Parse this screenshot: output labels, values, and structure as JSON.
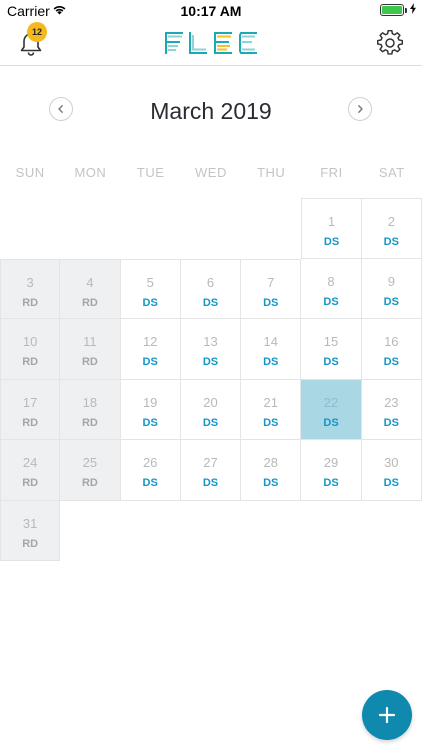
{
  "status_bar": {
    "carrier": "Carrier",
    "time": "10:17 AM"
  },
  "header": {
    "notification_count": "12",
    "logo_text": "FLEC"
  },
  "calendar": {
    "month_title": "March 2019",
    "weekdays": [
      "SUN",
      "MON",
      "TUE",
      "WED",
      "THU",
      "FRI",
      "SAT"
    ],
    "start_weekday_index": 5,
    "selected_day": "22",
    "days": [
      {
        "num": "1",
        "code": "DS"
      },
      {
        "num": "2",
        "code": "DS"
      },
      {
        "num": "3",
        "code": "RD"
      },
      {
        "num": "4",
        "code": "RD"
      },
      {
        "num": "5",
        "code": "DS"
      },
      {
        "num": "6",
        "code": "DS"
      },
      {
        "num": "7",
        "code": "DS"
      },
      {
        "num": "8",
        "code": "DS"
      },
      {
        "num": "9",
        "code": "DS"
      },
      {
        "num": "10",
        "code": "RD"
      },
      {
        "num": "11",
        "code": "RD"
      },
      {
        "num": "12",
        "code": "DS"
      },
      {
        "num": "13",
        "code": "DS"
      },
      {
        "num": "14",
        "code": "DS"
      },
      {
        "num": "15",
        "code": "DS"
      },
      {
        "num": "16",
        "code": "DS"
      },
      {
        "num": "17",
        "code": "RD"
      },
      {
        "num": "18",
        "code": "RD"
      },
      {
        "num": "19",
        "code": "DS"
      },
      {
        "num": "20",
        "code": "DS"
      },
      {
        "num": "21",
        "code": "DS"
      },
      {
        "num": "22",
        "code": "DS"
      },
      {
        "num": "23",
        "code": "DS"
      },
      {
        "num": "24",
        "code": "RD"
      },
      {
        "num": "25",
        "code": "RD"
      },
      {
        "num": "26",
        "code": "DS"
      },
      {
        "num": "27",
        "code": "DS"
      },
      {
        "num": "28",
        "code": "DS"
      },
      {
        "num": "29",
        "code": "DS"
      },
      {
        "num": "30",
        "code": "DS"
      },
      {
        "num": "31",
        "code": "RD"
      }
    ]
  },
  "colors": {
    "accent": "#0f89ad",
    "day_code": "#1497c6",
    "selected_day_bg": "#a9d7e3",
    "weekend_bg": "#eff0f2",
    "badge": "#f6b91c"
  },
  "icons": {
    "bell": "bell-icon",
    "settings": "gear-icon",
    "prev": "chevron-left-icon",
    "next": "chevron-right-icon",
    "add": "plus-icon"
  }
}
